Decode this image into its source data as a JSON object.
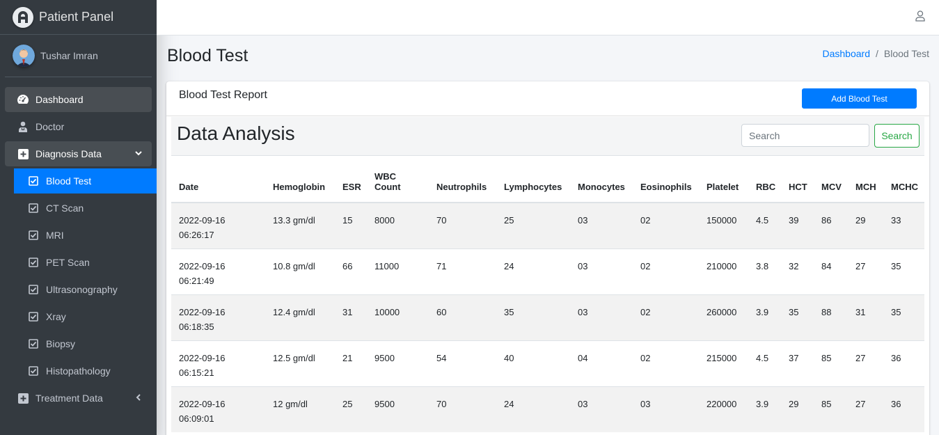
{
  "brand": {
    "title": "Patient Panel"
  },
  "user": {
    "name": "Tushar Imran"
  },
  "sidebar": {
    "items": [
      {
        "label": "Dashboard"
      },
      {
        "label": "Doctor"
      },
      {
        "label": "Diagnosis Data"
      },
      {
        "label": "Blood Test"
      },
      {
        "label": "CT Scan"
      },
      {
        "label": "MRI"
      },
      {
        "label": "PET Scan"
      },
      {
        "label": "Ultrasonography"
      },
      {
        "label": "Xray"
      },
      {
        "label": "Biopsy"
      },
      {
        "label": "Histopathology"
      },
      {
        "label": "Treatment Data"
      }
    ]
  },
  "header": {
    "title": "Blood Test",
    "breadcrumb": {
      "home": "Dashboard",
      "sep": "/",
      "current": "Blood Test"
    }
  },
  "card": {
    "title": "Blood Test Report",
    "add_button": "Add Blood Test",
    "analysis_title": "Data Analysis",
    "search_placeholder": "Search",
    "search_button": "Search"
  },
  "table": {
    "headers": [
      "Date",
      "Hemoglobin",
      "ESR",
      "WBC Count",
      "Neutrophils",
      "Lymphocytes",
      "Monocytes",
      "Eosinophils",
      "Platelet",
      "RBC",
      "HCT",
      "MCV",
      "MCH",
      "MCHC"
    ],
    "rows": [
      [
        "2022-09-16 06:26:17",
        "13.3 gm/dl",
        "15",
        "8000",
        "70",
        "25",
        "03",
        "02",
        "150000",
        "4.5",
        "39",
        "86",
        "29",
        "33"
      ],
      [
        "2022-09-16 06:21:49",
        "10.8 gm/dl",
        "66",
        "11000",
        "71",
        "24",
        "03",
        "02",
        "210000",
        "3.8",
        "32",
        "84",
        "27",
        "35"
      ],
      [
        "2022-09-16 06:18:35",
        "12.4 gm/dl",
        "31",
        "10000",
        "60",
        "35",
        "03",
        "02",
        "260000",
        "3.9",
        "35",
        "88",
        "31",
        "35"
      ],
      [
        "2022-09-16 06:15:21",
        "12.5 gm/dl",
        "21",
        "9500",
        "54",
        "40",
        "04",
        "02",
        "215000",
        "4.5",
        "37",
        "85",
        "27",
        "36"
      ],
      [
        "2022-09-16 06:09:01",
        "12 gm/dl",
        "25",
        "9500",
        "70",
        "24",
        "03",
        "03",
        "220000",
        "3.9",
        "29",
        "85",
        "27",
        "36"
      ]
    ]
  }
}
